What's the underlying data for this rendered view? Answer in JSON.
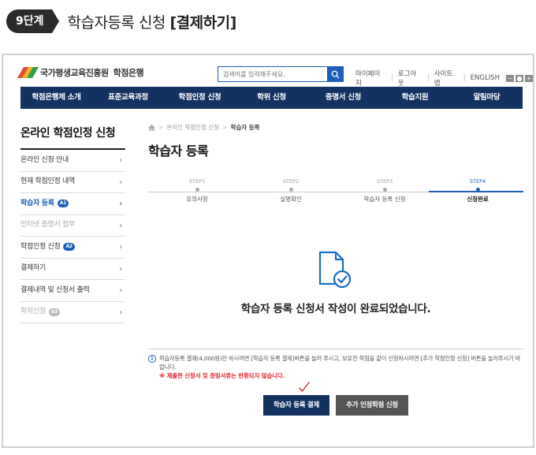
{
  "step_header": {
    "badge": "9단계",
    "title": "학습자등록 신청 ",
    "title_bold": "[결제하기]"
  },
  "header": {
    "logo_text": "국가평생교육진흥원",
    "logo_sub": "학점은행",
    "search_placeholder": "검색어를 입력해주세요.",
    "util": [
      "마이페이지",
      "로그아웃",
      "사이트맵",
      "ENGLISH"
    ],
    "zoom": [
      "−",
      "●",
      "+"
    ]
  },
  "gnb": [
    "학점은행제 소개",
    "표준교육과정",
    "학점인정 신청",
    "학위 신청",
    "증명서 신청",
    "학습지원",
    "알림마당"
  ],
  "sidebar": {
    "title": "온라인 학점인정 신청",
    "items": [
      {
        "label": "온라인 신청 안내",
        "tag": "",
        "state": "normal"
      },
      {
        "label": "현재 학점인정 내역",
        "tag": "",
        "state": "normal"
      },
      {
        "label": "학습자 등록",
        "tag": "A1",
        "state": "active"
      },
      {
        "label": "인터넷 증명서 첨부",
        "tag": "",
        "state": "disabled"
      },
      {
        "label": "학점인정 신청",
        "tag": "A2",
        "state": "normal"
      },
      {
        "label": "결제하기",
        "tag": "",
        "state": "normal"
      },
      {
        "label": "결제내역 및 신청서 출력",
        "tag": "",
        "state": "normal"
      },
      {
        "label": "학위신청",
        "tag": "A3",
        "state": "disabled"
      }
    ]
  },
  "breadcrumb": {
    "items": [
      "온라인 학점인정 신청",
      "학습자 등록"
    ]
  },
  "page_title": "학습자 등록",
  "steps": [
    {
      "num": "STEP1",
      "label": "유의사항",
      "active": false
    },
    {
      "num": "STEP2",
      "label": "실명확인",
      "active": false
    },
    {
      "num": "STEP3",
      "label": "학습자 등록 신청",
      "active": false
    },
    {
      "num": "STEP4",
      "label": "신청완료",
      "active": true
    }
  ],
  "complete_message": "학습자 등록 신청서 작성이 완료되었습니다.",
  "notice": {
    "text": "학습자등록 결제(4,000원)만 하시려면 [학습자 등록 결제]버튼을 눌러 주시고, 보유한 학점을 같이 신청하시려면 [추가 학점인정 신청] 버튼을 눌러주시기 바랍니다.",
    "warning": "※ 제출한 신청서 및 증빙서류는 반환되지 않습니다."
  },
  "buttons": {
    "primary": "학습자 등록 결제",
    "secondary": "추가 인정학점 신청"
  },
  "colors": {
    "navy": "#12325f",
    "blue": "#1b5fb8",
    "warning": "#e0202a"
  }
}
